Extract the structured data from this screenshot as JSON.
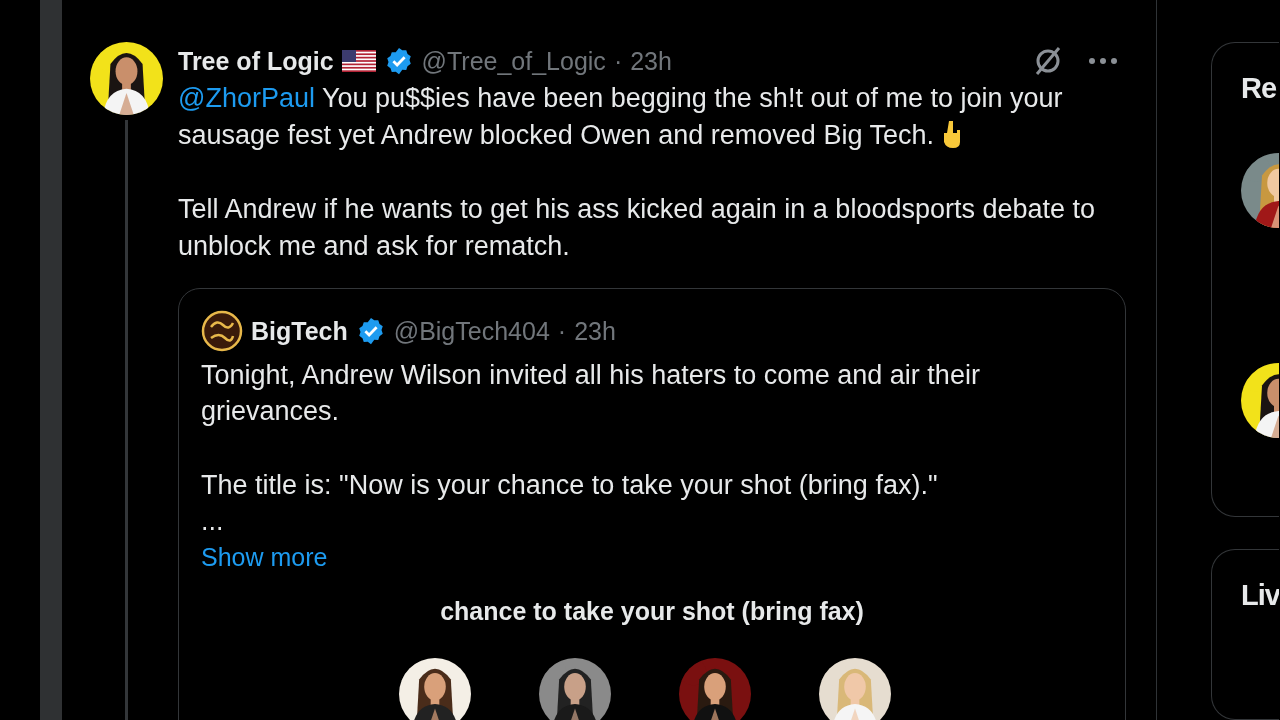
{
  "tweet": {
    "author": "Tree of Logic",
    "verified": true,
    "handle": "@Tree_of_Logic",
    "separator": "·",
    "time": "23h",
    "mention": "@ZhorPaul",
    "paragraphs": [
      "You pu$$ies have been begging the sh!t out of me to join your sausage fest yet Andrew blocked Owen and removed Big Tech.",
      "Tell Andrew if he wants to get his ass kicked again in a bloodsports debate to unblock me and ask for rematch."
    ],
    "quote": {
      "author": "BigTech",
      "verified": true,
      "handle": "@BigTech404",
      "separator": "·",
      "time": "23h",
      "paragraphs": [
        "Tonight, Andrew Wilson invited all his haters to come and air their grievances.",
        "The title is: \"Now is your chance to take your shot (bring fax).\"\n..."
      ],
      "show_more": "Show more",
      "card_title": "chance to take your shot (bring fax)"
    }
  },
  "sidebar": {
    "panels": [
      {
        "title": "Re"
      },
      {
        "title": "Liv"
      }
    ]
  }
}
